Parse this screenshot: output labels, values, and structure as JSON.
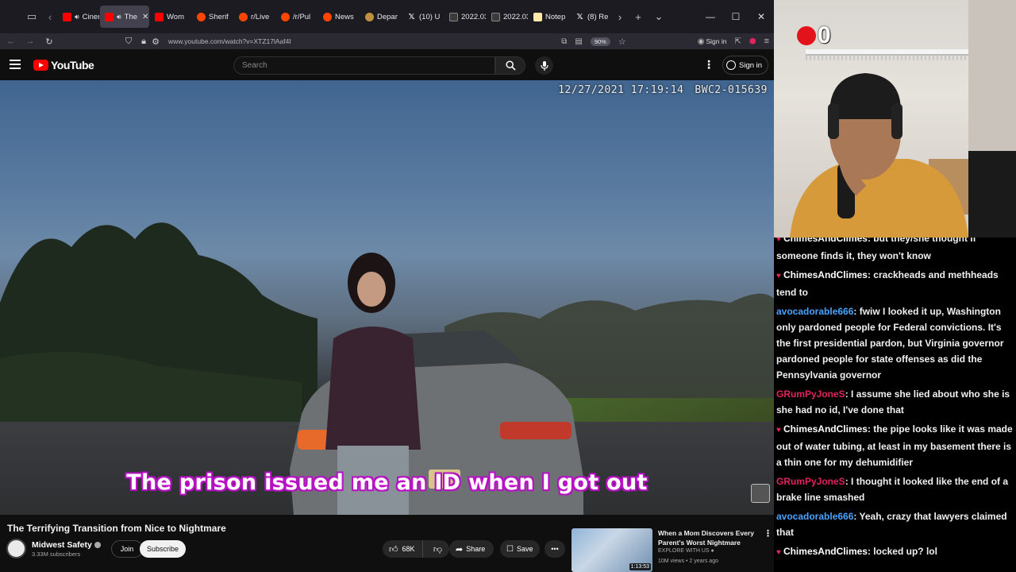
{
  "browser": {
    "tabs": [
      {
        "label": "Cinem",
        "favicon": "youtube-icon",
        "speaker": true,
        "active": false
      },
      {
        "label": "The",
        "favicon": "youtube-icon",
        "speaker": true,
        "active": true
      },
      {
        "label": "Wom",
        "favicon": "youtube-icon",
        "speaker": false,
        "active": false
      },
      {
        "label": "Sherif",
        "favicon": "reddit-icon",
        "speaker": false,
        "active": false
      },
      {
        "label": "r/Live",
        "favicon": "reddit-icon",
        "speaker": false,
        "active": false
      },
      {
        "label": "/r/Pul",
        "favicon": "reddit-icon",
        "speaker": false,
        "active": false
      },
      {
        "label": "News",
        "favicon": "reddit-icon",
        "speaker": false,
        "active": false
      },
      {
        "label": "Depar",
        "favicon": "seal-icon",
        "speaker": false,
        "active": false
      },
      {
        "label": "(10) U",
        "favicon": "x-icon",
        "speaker": false,
        "active": false
      },
      {
        "label": "2022.03.1",
        "favicon": "document-icon",
        "speaker": false,
        "active": false
      },
      {
        "label": "2022.03.1",
        "favicon": "document-icon",
        "speaker": false,
        "active": false
      },
      {
        "label": "Notep",
        "favicon": "notepad-icon",
        "speaker": false,
        "active": false
      },
      {
        "label": "(8) Re",
        "favicon": "x-icon",
        "speaker": false,
        "active": false
      }
    ],
    "url": "www.youtube.com/watch?v=XTZ17lAaf4I",
    "zoom": "90%",
    "signin": "Sign in"
  },
  "youtube": {
    "logo": "YouTube",
    "search_placeholder": "Search",
    "signin": "Sign in"
  },
  "video": {
    "bodycam_timestamp": "12/27/2021 17:19:14",
    "bodycam_id": "BWC2-015639",
    "subtitle": "The prison issued me an ID when I got out",
    "title": "The Terrifying Transition from Nice to Nightmare",
    "channel": "Midwest Safety",
    "subscribers": "3.33M subscribers",
    "join": "Join",
    "subscribe": "Subscribe",
    "likes": "68K",
    "share": "Share",
    "save": "Save"
  },
  "recommended": {
    "title": "When a Mom Discovers Every Parent's Worst Nightmare",
    "channel": "EXPLORE WITH US",
    "meta": "10M views • 2 years ago",
    "duration": "1:13:53"
  },
  "webcam": {
    "badge_count": "0"
  },
  "chat": {
    "messages": [
      {
        "user": "ChimesAndClimes",
        "text": ": but they/she thought if someone finds it, they won't know",
        "color": "#ffffff",
        "heart": true
      },
      {
        "user": "ChimesAndClimes",
        "text": ": crackheads and methheads tend to",
        "color": "#ffffff",
        "heart": true
      },
      {
        "user": "avocadorable666",
        "text": ": fwiw I looked it up, Washington only pardoned people for Federal convictions. It's the first presidential pardon, but Virginia governor pardoned people for state offenses as did the Pennsylvania governor",
        "color": "#4aa3ff",
        "heart": false
      },
      {
        "user": "GRumPyJoneS",
        "text": ": I assume she lied about who she is she had no id, I've done that",
        "color": "#e0245e",
        "heart": false
      },
      {
        "user": "ChimesAndClimes",
        "text": ": the pipe looks like it was made out of water tubing, at least in my basement there is a thin one for my dehumidifier",
        "color": "#ffffff",
        "heart": true
      },
      {
        "user": "GRumPyJoneS",
        "text": ": I thought it looked like the end of a brake line smashed",
        "color": "#e0245e",
        "heart": false
      },
      {
        "user": "avocadorable666",
        "text": ": Yeah, crazy that lawyers claimed that",
        "color": "#4aa3ff",
        "heart": false
      },
      {
        "user": "ChimesAndClimes",
        "text": ": locked up? lol",
        "color": "#ffffff",
        "heart": true
      }
    ]
  }
}
